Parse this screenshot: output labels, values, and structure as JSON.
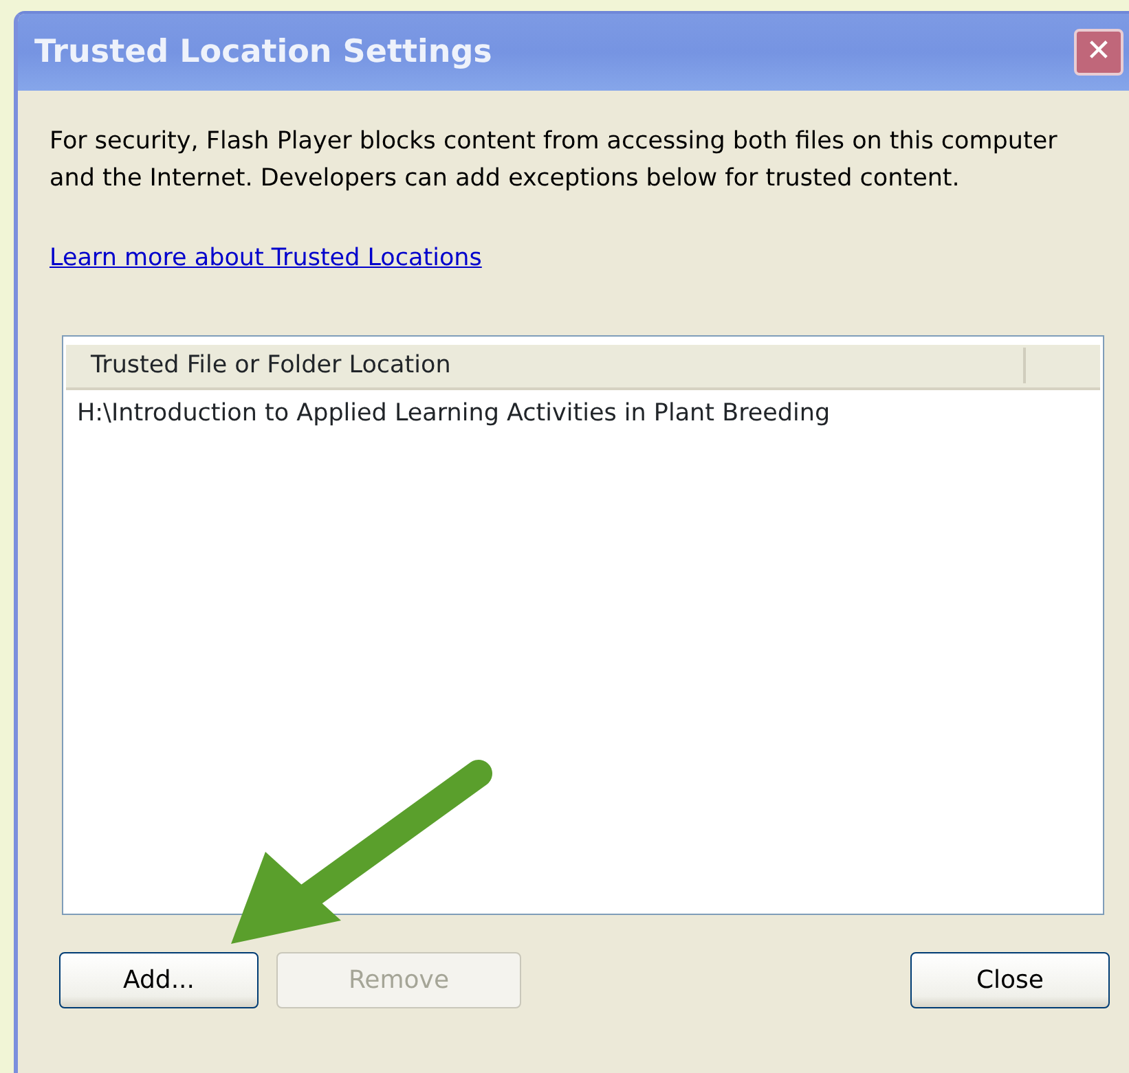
{
  "window": {
    "title": "Trusted Location Settings",
    "close_glyph": "✕"
  },
  "description": "For security, Flash Player blocks content from accessing both files on this computer and the Internet. Developers can add exceptions below for trusted content.",
  "learn_more_link": "Learn more about Trusted Locations",
  "table": {
    "columns": [
      "Trusted File or Folder Location"
    ],
    "rows": [
      {
        "location": "H:\\Introduction to Applied Learning Activities in Plant Breeding"
      }
    ]
  },
  "left_buttons": [
    {
      "label": "Add...",
      "disabled": false
    },
    {
      "label": "Remove",
      "disabled": true
    }
  ],
  "right_buttons": [
    {
      "label": "Close",
      "disabled": false
    }
  ]
}
